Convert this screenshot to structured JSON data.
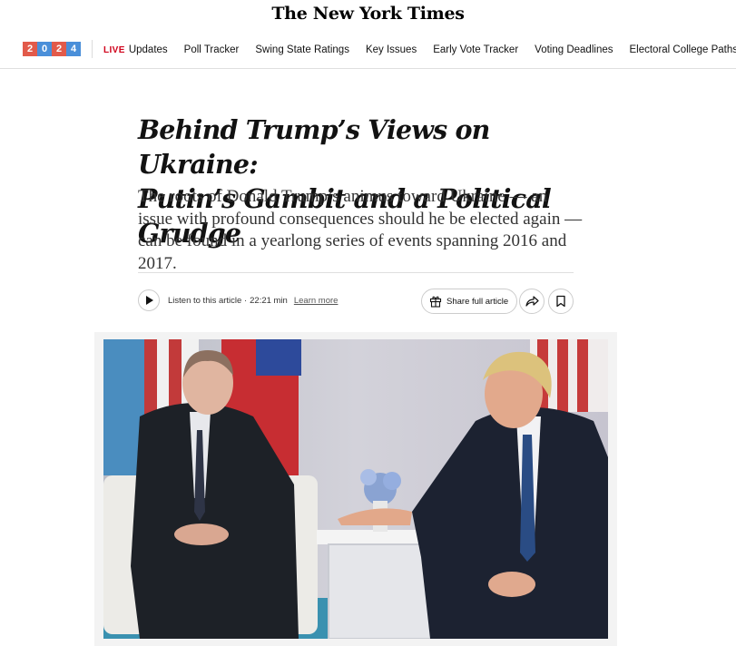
{
  "masthead": {
    "logo": "The New York Times"
  },
  "nav": {
    "badge_digits": [
      "2",
      "0",
      "2",
      "4"
    ],
    "live_label": "LIVE",
    "items": [
      "Updates",
      "Poll Tracker",
      "Swing State Ratings",
      "Key Issues",
      "Early Vote Tracker",
      "Voting Deadlines",
      "Electoral College Paths"
    ]
  },
  "article": {
    "headline_line1": "Behind Trump’s Views on Ukraine:",
    "headline_line2": "Putin’s Gambit and a Political Grudge",
    "summary": "The roots of Donald Trump’s animus toward Ukraine — an issue with profound consequences should he be elected again — can be found in a yearlong series of events spanning 2016 and 2017."
  },
  "audio": {
    "listen_label": "Listen to this article ·",
    "duration": "22:21 min",
    "learn_more": "Learn more"
  },
  "actions": {
    "share_full_label": "Share full article"
  },
  "icons": {
    "play": "play-icon",
    "gift": "gift-icon",
    "share": "share-arrow-icon",
    "bookmark": "bookmark-icon"
  },
  "colors": {
    "live": "#d0021b",
    "badge_red": "#e25a4a",
    "badge_blue": "#4a8fd9"
  }
}
